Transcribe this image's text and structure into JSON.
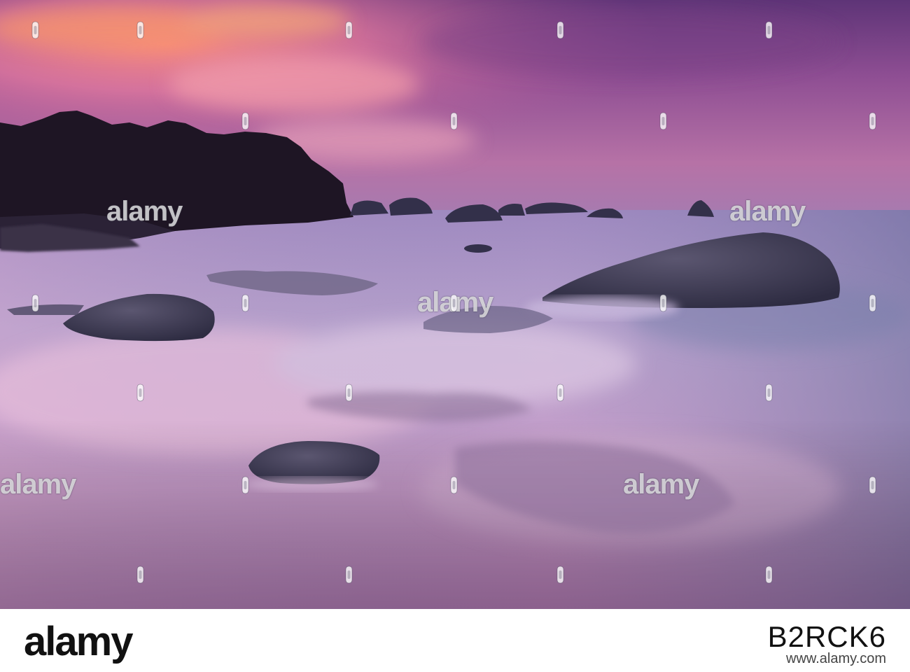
{
  "photo": {
    "subject": "coastline-sunset",
    "colors": {
      "sky_top": "#6d3a82",
      "sky_glow": "#f29aa8",
      "horizon": "#a66fa6",
      "water": "#b09ac6",
      "rocks": "#3a3852",
      "treeline": "#1c1220"
    }
  },
  "watermark": {
    "text": "alamy",
    "icon": "watermark-dot-icon"
  },
  "footer": {
    "logo_text": "alamy",
    "image_id": "B2RCK6",
    "url": "www.alamy.com"
  }
}
